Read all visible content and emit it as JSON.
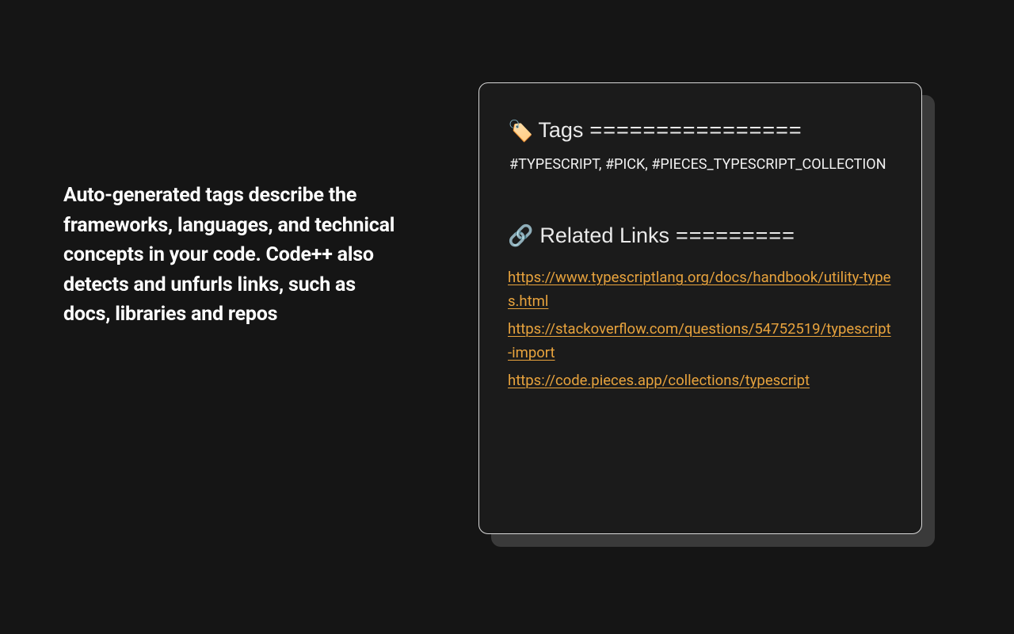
{
  "left": {
    "description": "Auto-generated tags describe the frameworks, languages, and technical concepts in your code. Code++ also detects and unfurls links, such as docs, libraries and repos"
  },
  "card": {
    "tags_section": {
      "icon": "🏷️",
      "title": "Tags",
      "fill": "================",
      "tags_text": "#TYPESCRIPT, #PICK, #PIECES_TYPESCRIPT_COLLECTION"
    },
    "links_section": {
      "icon": "🔗",
      "title": "Related Links",
      "fill": "=========",
      "links": [
        "https://www.typescriptlang.org/docs/handbook/utility-types.html",
        "https://stackoverflow.com/questions/54752519/typescript-import",
        "https://code.pieces.app/collections/typescript"
      ]
    }
  }
}
